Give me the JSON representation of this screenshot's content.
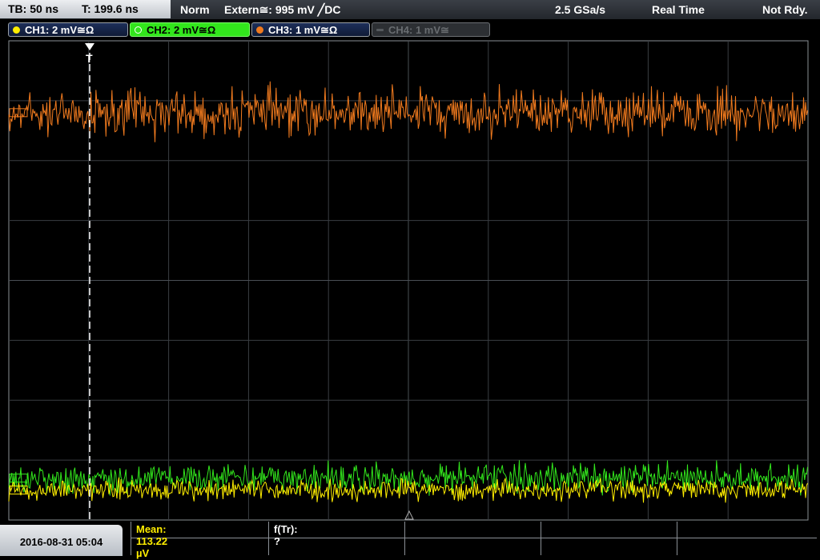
{
  "header": {
    "timebase": "TB: 50 ns",
    "trigger_time": "T: 199.6 ns",
    "trigger_mode": "Norm",
    "trigger_source": "Extern≅: 995 mV ╱DC",
    "sample_rate": "2.5 GSa/s",
    "acq_mode": "Real Time",
    "run_state": "Not Rdy."
  },
  "channels": [
    {
      "label": "CH1: 2 mV≅Ω",
      "color": "#ffee00",
      "state": "on"
    },
    {
      "label": "CH2: 2 mV≅Ω",
      "color": "#32e61c",
      "state": "selected"
    },
    {
      "label": "CH3: 1 mV≅Ω",
      "color": "#f07a1e",
      "state": "on"
    },
    {
      "label": "CH4: 1 mV≅",
      "color": "#6b6f73",
      "state": "off"
    }
  ],
  "trigger_marker": "T",
  "measurements": {
    "mean_label": "Mean: 113.22 µV",
    "freq_label": "f(Tr): ?"
  },
  "footer": {
    "datetime": "2016-08-31 05:04"
  },
  "chart_data": {
    "type": "line",
    "title": "",
    "grid": true,
    "divisions": {
      "x": 10,
      "y": 8
    },
    "series": [
      {
        "name": "CH3",
        "color": "#f07a1e",
        "offset_div": 1.2,
        "noise_div": 0.55
      },
      {
        "name": "CH2",
        "color": "#32e61c",
        "offset_div": 7.3,
        "noise_div": 0.35
      },
      {
        "name": "CH1",
        "color": "#ffee00",
        "offset_div": 7.5,
        "noise_div": 0.25
      }
    ]
  }
}
